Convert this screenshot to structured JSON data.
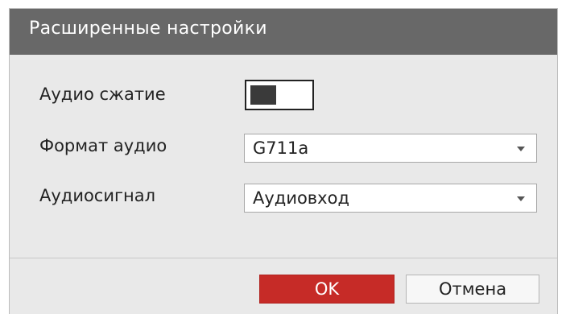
{
  "dialog": {
    "title": "Расширенные настройки"
  },
  "fields": {
    "audio_compression": {
      "label": "Аудио сжатие",
      "enabled": false
    },
    "audio_format": {
      "label": "Формат аудио",
      "value": "G711a"
    },
    "audio_signal": {
      "label": "Аудиосигнал",
      "value": "Аудиовход"
    }
  },
  "buttons": {
    "ok_label": "OK",
    "cancel_label": "Отмена"
  },
  "colors": {
    "titlebar": "#686868",
    "dialog_bg": "#e9e9e9",
    "ok_button": "#c62b27"
  },
  "icons": {
    "dropdown": "chevron-down-icon"
  }
}
